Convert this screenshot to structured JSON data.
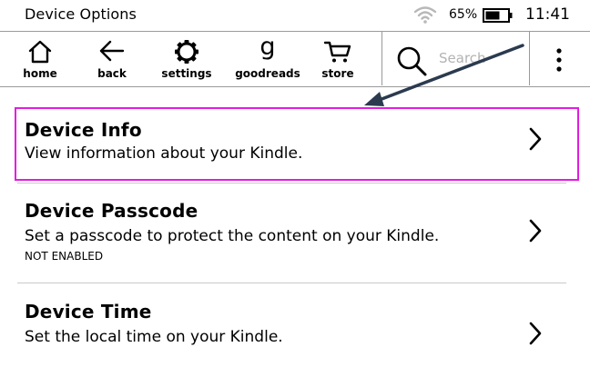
{
  "status_bar": {
    "title": "Device Options",
    "battery_percent": "65%",
    "battery_level": 0.65,
    "time": "11:41",
    "wifi_icon": "wifi-icon",
    "battery_icon": "battery-icon"
  },
  "toolbar": {
    "home_label": "home",
    "back_label": "back",
    "settings_label": "settings",
    "goodreads_label": "goodreads",
    "goodreads_glyph": "g",
    "store_label": "store",
    "search_placeholder": "Search",
    "search_value": "",
    "menu_icon": "vertical-ellipsis-icon"
  },
  "items": [
    {
      "title": "Device Info",
      "description": "View information about your Kindle.",
      "status": ""
    },
    {
      "title": "Device Passcode",
      "description": "Set a passcode to protect the content on your Kindle.",
      "status": "NOT ENABLED"
    },
    {
      "title": "Device Time",
      "description": "Set the local time on your Kindle.",
      "status": ""
    }
  ],
  "colors": {
    "highlight": "#e31cdf",
    "annotation_arrow": "#2b3a4f",
    "divider": "#c9c9c9"
  }
}
